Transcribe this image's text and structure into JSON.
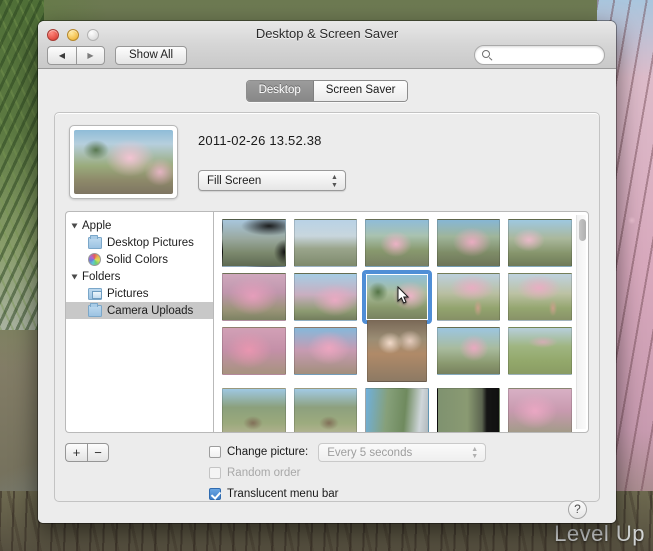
{
  "desktop": {
    "watermark": "Level Up"
  },
  "window": {
    "title": "Desktop & Screen Saver",
    "traffic": {
      "close": "close-button",
      "minimize": "minimize-button",
      "zoom": "zoom-button"
    },
    "back_label": "◀",
    "forward_label": "▶",
    "show_all_label": "Show All",
    "search": {
      "value": "",
      "placeholder": ""
    }
  },
  "tabs": [
    {
      "label": "Desktop",
      "active": true
    },
    {
      "label": "Screen Saver",
      "active": false
    }
  ],
  "preview": {
    "filename": "2011-02-26 13.52.38",
    "fit_popup": {
      "value": "Fill Screen"
    }
  },
  "sidebar": {
    "items": [
      {
        "label": "Apple",
        "type": "group",
        "selected": false
      },
      {
        "label": "Desktop Pictures",
        "type": "folder",
        "selected": false
      },
      {
        "label": "Solid Colors",
        "type": "wheel",
        "selected": false
      },
      {
        "label": "Folders",
        "type": "group",
        "selected": false
      },
      {
        "label": "Pictures",
        "type": "pics",
        "selected": false
      },
      {
        "label": "Camera Uploads",
        "type": "folder",
        "selected": true
      }
    ]
  },
  "grid": {
    "selected_index": 7,
    "thumbnails": [
      {
        "name": "thumb-mountain-snow-dark",
        "orientation": "landscape"
      },
      {
        "name": "thumb-mountain-bare-trees",
        "orientation": "landscape"
      },
      {
        "name": "thumb-blossom-road",
        "orientation": "landscape"
      },
      {
        "name": "thumb-blossom-grove",
        "orientation": "landscape"
      },
      {
        "name": "thumb-blossom-park-people",
        "orientation": "landscape"
      },
      {
        "name": "thumb-blossom-pink-dense",
        "orientation": "landscape"
      },
      {
        "name": "thumb-blossom-sky-wide",
        "orientation": "landscape"
      },
      {
        "name": "thumb-blossom-path-selected",
        "orientation": "landscape"
      },
      {
        "name": "thumb-woman-lawn-a",
        "orientation": "landscape"
      },
      {
        "name": "thumb-woman-lawn-b",
        "orientation": "landscape"
      },
      {
        "name": "thumb-branch-closeup-a",
        "orientation": "landscape"
      },
      {
        "name": "thumb-branch-closeup-b",
        "orientation": "landscape"
      },
      {
        "name": "thumb-two-people-portrait",
        "orientation": "portrait"
      },
      {
        "name": "thumb-blossom-parking",
        "orientation": "landscape"
      },
      {
        "name": "thumb-lawn-field",
        "orientation": "landscape"
      },
      {
        "name": "thumb-hut-hills-a",
        "orientation": "landscape"
      },
      {
        "name": "thumb-hut-hills-b",
        "orientation": "landscape"
      },
      {
        "name": "thumb-bridge-river",
        "orientation": "landscape"
      },
      {
        "name": "thumb-valley-dark-edge",
        "orientation": "landscape"
      },
      {
        "name": "thumb-blossom-tree-pink",
        "orientation": "landscape"
      }
    ]
  },
  "bottom": {
    "add_label": "+",
    "remove_label": "−",
    "change_picture": {
      "label": "Change picture:",
      "checked": false
    },
    "interval_popup": {
      "value": "Every 5 seconds",
      "enabled": false
    },
    "random_order": {
      "label": "Random order",
      "checked": false,
      "enabled": false
    },
    "translucent_menu_bar": {
      "label": "Translucent menu bar",
      "checked": true
    },
    "help_label": "?"
  }
}
